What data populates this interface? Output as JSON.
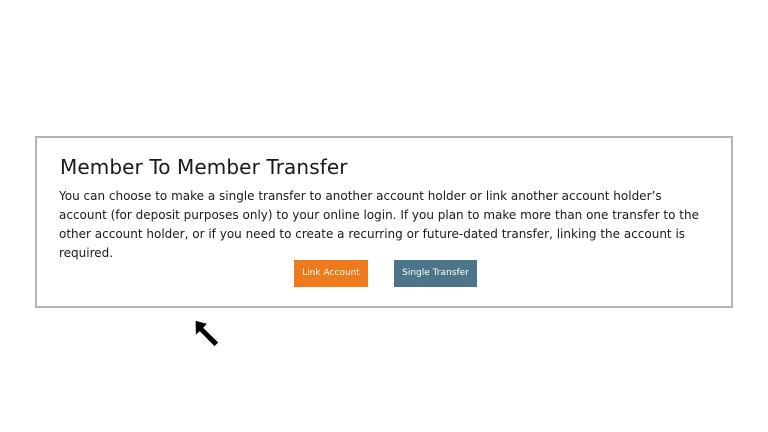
{
  "transfer_panel": {
    "title": "Member To Member Transfer",
    "description": "You can choose to make a single transfer to another account holder or link another account holder’s account (for deposit purposes only) to your online login. If you plan to make more than one transfer to the other account holder, or if you need to create a recurring or future-dated transfer, linking the account is required.",
    "buttons": {
      "link_account": "Link Account",
      "single_transfer": "Single Transfer"
    }
  },
  "colors": {
    "link_account_bg": "#ee7a1b",
    "single_transfer_bg": "#4d7589",
    "panel_border": "#b5b5b5"
  },
  "icons": {
    "cursor": "mouse-pointer-icon"
  }
}
